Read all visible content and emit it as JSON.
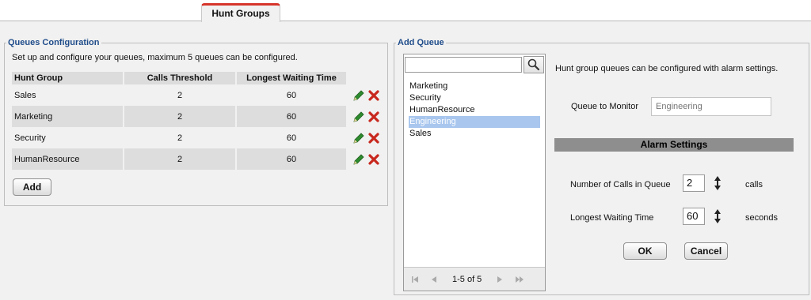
{
  "tab": {
    "label": "Hunt Groups"
  },
  "queues": {
    "legend": "Queues Configuration",
    "description": "Set up and configure your queues, maximum 5 queues can be configured.",
    "columns": [
      "Hunt Group",
      "Calls Threshold",
      "Longest Waiting Time"
    ],
    "rows": [
      {
        "name": "Sales",
        "threshold": "2",
        "wait": "60"
      },
      {
        "name": "Marketing",
        "threshold": "2",
        "wait": "60"
      },
      {
        "name": "Security",
        "threshold": "2",
        "wait": "60"
      },
      {
        "name": "HumanResource",
        "threshold": "2",
        "wait": "60"
      }
    ],
    "add_label": "Add"
  },
  "add_queue": {
    "legend": "Add Queue",
    "search_value": "",
    "list": [
      "Marketing",
      "Security",
      "HumanResource",
      "Engineering",
      "Sales"
    ],
    "selected_item": "Engineering",
    "pager_text": "1-5 of 5",
    "info": "Hunt group queues can be configured with alarm settings.",
    "queue_to_monitor_label": "Queue to Monitor",
    "queue_to_monitor_placeholder": "Engineering",
    "alarm_header": "Alarm Settings",
    "calls_label": "Number of Calls in Queue",
    "calls_value": "2",
    "calls_unit": "calls",
    "wait_label": "Longest Waiting Time",
    "wait_value": "60",
    "wait_unit": "seconds",
    "ok_label": "OK",
    "cancel_label": "Cancel"
  },
  "colors": {
    "tab_accent": "#d6342a",
    "legend_text": "#1f4c8a",
    "selection": "#a8c6ee",
    "edit_icon": "#2e8b2e",
    "delete_icon": "#c8281e"
  }
}
